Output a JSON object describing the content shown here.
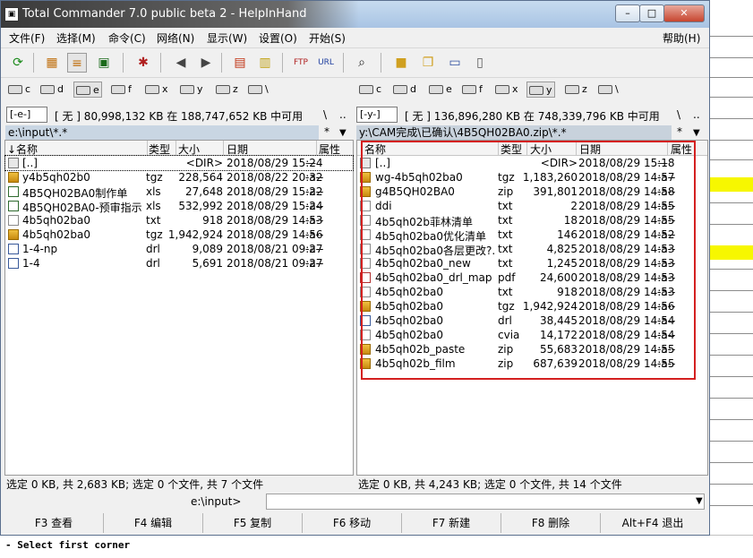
{
  "window": {
    "title": "Total Commander 7.0 public beta 2 - HelpInHand",
    "min_label": "–",
    "max_label": "□",
    "close_label": "✕"
  },
  "menu": [
    "文件(F)",
    "选择(M)",
    "命令(C)",
    "网络(N)",
    "显示(W)",
    "设置(O)",
    "开始(S)"
  ],
  "help_menu": "帮助(H)",
  "drives": [
    "c",
    "d",
    "e",
    "f",
    "x",
    "y",
    "z",
    "\\"
  ],
  "left": {
    "drive_combo": "[-e-]",
    "info": "[ 无 ]  80,998,132 KB 在 188,747,652 KB 中可用",
    "root_btn": "\\",
    "up_btn": "..",
    "path": "e:\\input\\*.*",
    "filter_star": "*",
    "columns": {
      "name": "↓名称",
      "ext": "类型",
      "size": "大小",
      "date": "日期",
      "attr": "属性"
    },
    "rows": [
      {
        "icon": "up",
        "name": "[..]",
        "ext": "",
        "size": "<DIR>",
        "date": "2018/08/29 15:24",
        "attr": "—"
      },
      {
        "icon": "arc",
        "name": "y4b5qh02b0",
        "ext": "tgz",
        "size": "228,564",
        "date": "2018/08/22 20:32",
        "attr": "-a--"
      },
      {
        "icon": "xls",
        "name": "4B5QH02BA0制作单",
        "ext": "xls",
        "size": "27,648",
        "date": "2018/08/29 15:22",
        "attr": "-a--"
      },
      {
        "icon": "xls",
        "name": "4B5QH02BA0-预审指示",
        "ext": "xls",
        "size": "532,992",
        "date": "2018/08/29 15:24",
        "attr": "-a--"
      },
      {
        "icon": "file",
        "name": "4b5qh02ba0",
        "ext": "txt",
        "size": "918",
        "date": "2018/08/29 14:53",
        "attr": "-a--"
      },
      {
        "icon": "arc",
        "name": "4b5qh02ba0",
        "ext": "tgz",
        "size": "1,942,924",
        "date": "2018/08/29 14:56",
        "attr": "-a--"
      },
      {
        "icon": "drl",
        "name": "1-4-np",
        "ext": "drl",
        "size": "9,089",
        "date": "2018/08/21 09:27",
        "attr": "-a--"
      },
      {
        "icon": "drl",
        "name": "1-4",
        "ext": "drl",
        "size": "5,691",
        "date": "2018/08/21 09:27",
        "attr": "-a--"
      }
    ],
    "status": "选定 0 KB, 共 2,683 KB; 选定 0 个文件, 共 7 个文件"
  },
  "right": {
    "drive_combo": "[-y-]",
    "info": "[ 无 ]  136,896,280 KB 在 748,339,796 KB 中可用",
    "root_btn": "\\",
    "up_btn": "..",
    "path": "y:\\CAM完成\\已确认\\4B5QH02BA0.zip\\*.*",
    "filter_star": "*",
    "columns": {
      "name": "名称",
      "ext": "类型",
      "size": "大小",
      "date": "日期",
      "attr": "属性"
    },
    "rows": [
      {
        "icon": "up",
        "name": "[..]",
        "ext": "",
        "size": "<DIR>",
        "date": "2018/08/29 15:18",
        "attr": "—"
      },
      {
        "icon": "arc",
        "name": "wg-4b5qh02ba0",
        "ext": "tgz",
        "size": "1,183,260",
        "date": "2018/08/29 14:57",
        "attr": "-a--"
      },
      {
        "icon": "arc",
        "name": "g4B5QH02BA0",
        "ext": "zip",
        "size": "391,801",
        "date": "2018/08/29 14:58",
        "attr": "-a--"
      },
      {
        "icon": "file",
        "name": "ddi",
        "ext": "txt",
        "size": "2",
        "date": "2018/08/29 14:55",
        "attr": "-a--"
      },
      {
        "icon": "file",
        "name": "4b5qh02b菲林清单",
        "ext": "txt",
        "size": "18",
        "date": "2018/08/29 14:55",
        "attr": "-a--"
      },
      {
        "icon": "file",
        "name": "4b5qh02ba0优化清单",
        "ext": "txt",
        "size": "146",
        "date": "2018/08/29 14:52",
        "attr": "-a--"
      },
      {
        "icon": "file",
        "name": "4b5qh02ba0各层更改?.",
        "ext": "txt",
        "size": "4,825",
        "date": "2018/08/29 14:53",
        "attr": "-a--"
      },
      {
        "icon": "file",
        "name": "4b5qh02ba0_new",
        "ext": "txt",
        "size": "1,245",
        "date": "2018/08/29 14:53",
        "attr": "-a--"
      },
      {
        "icon": "pdf",
        "name": "4b5qh02ba0_drl_map",
        "ext": "pdf",
        "size": "24,600",
        "date": "2018/08/29 14:53",
        "attr": "-a--"
      },
      {
        "icon": "file",
        "name": "4b5qh02ba0",
        "ext": "txt",
        "size": "918",
        "date": "2018/08/29 14:53",
        "attr": "-a--"
      },
      {
        "icon": "arc",
        "name": "4b5qh02ba0",
        "ext": "tgz",
        "size": "1,942,924",
        "date": "2018/08/29 14:56",
        "attr": "-a--"
      },
      {
        "icon": "drl",
        "name": "4b5qh02ba0",
        "ext": "drl",
        "size": "38,445",
        "date": "2018/08/29 14:54",
        "attr": "-a--"
      },
      {
        "icon": "file",
        "name": "4b5qh02ba0",
        "ext": "cvia",
        "size": "14,172",
        "date": "2018/08/29 14:54",
        "attr": "-a--"
      },
      {
        "icon": "arc",
        "name": "4b5qh02b_paste",
        "ext": "zip",
        "size": "55,683",
        "date": "2018/08/29 14:55",
        "attr": "-a--"
      },
      {
        "icon": "arc",
        "name": "4b5qh02b_film",
        "ext": "zip",
        "size": "687,639",
        "date": "2018/08/29 14:55",
        "attr": "-a--"
      }
    ],
    "status": "选定 0 KB, 共 4,243 KB; 选定 0 个文件, 共 14 个文件"
  },
  "command": {
    "label": "e:\\input>",
    "value": ""
  },
  "fkeys": [
    "F3 查看",
    "F4 编辑",
    "F5 复制",
    "F6 移动",
    "F7 新建",
    "F8 删除",
    "Alt+F4 退出"
  ],
  "background_console": "- Select first corner",
  "colors": {
    "highlight_box": "#d42020",
    "path_active": "#c9d6e3"
  }
}
